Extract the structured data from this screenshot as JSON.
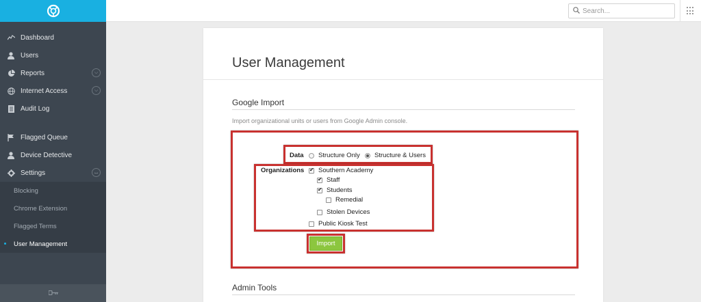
{
  "sidebar": {
    "nav": [
      {
        "label": "Dashboard",
        "icon": "chart-line-icon"
      },
      {
        "label": "Users",
        "icon": "user-icon"
      },
      {
        "label": "Reports",
        "icon": "pie-chart-icon",
        "expandable": true
      },
      {
        "label": "Internet Access",
        "icon": "globe-icon",
        "expandable": true
      },
      {
        "label": "Audit Log",
        "icon": "document-icon"
      }
    ],
    "nav2": [
      {
        "label": "Flagged Queue",
        "icon": "flag-icon"
      },
      {
        "label": "Device Detective",
        "icon": "user-icon"
      },
      {
        "label": "Settings",
        "icon": "gear-icon",
        "expanded": true
      }
    ],
    "settings_items": [
      "Blocking",
      "Chrome Extension",
      "Flagged Terms",
      "User Management"
    ],
    "active_item": "User Management",
    "brand_color": "#19b0e1"
  },
  "topbar": {
    "search_placeholder": "Search..."
  },
  "page": {
    "title": "User Management",
    "section_title": "Google Import",
    "section_desc": "Import organizational units or users from Google Admin console.",
    "data_label": "Data",
    "data_options": [
      {
        "label": "Structure Only",
        "selected": false
      },
      {
        "label": "Structure & Users",
        "selected": true
      }
    ],
    "orgs_label": "Organizations",
    "orgs": [
      {
        "label": "Southern Academy",
        "checked": true
      },
      {
        "label": "Staff",
        "checked": true
      },
      {
        "label": "Students",
        "checked": true
      },
      {
        "label": "Remedial",
        "checked": false
      },
      {
        "label": "Stolen Devices",
        "checked": false
      },
      {
        "label": "Public Kiosk Test",
        "checked": false
      }
    ],
    "import_label": "Import",
    "admin_title": "Admin Tools"
  },
  "colors": {
    "highlight": "#c8312f",
    "import_button": "#8cc63f"
  }
}
